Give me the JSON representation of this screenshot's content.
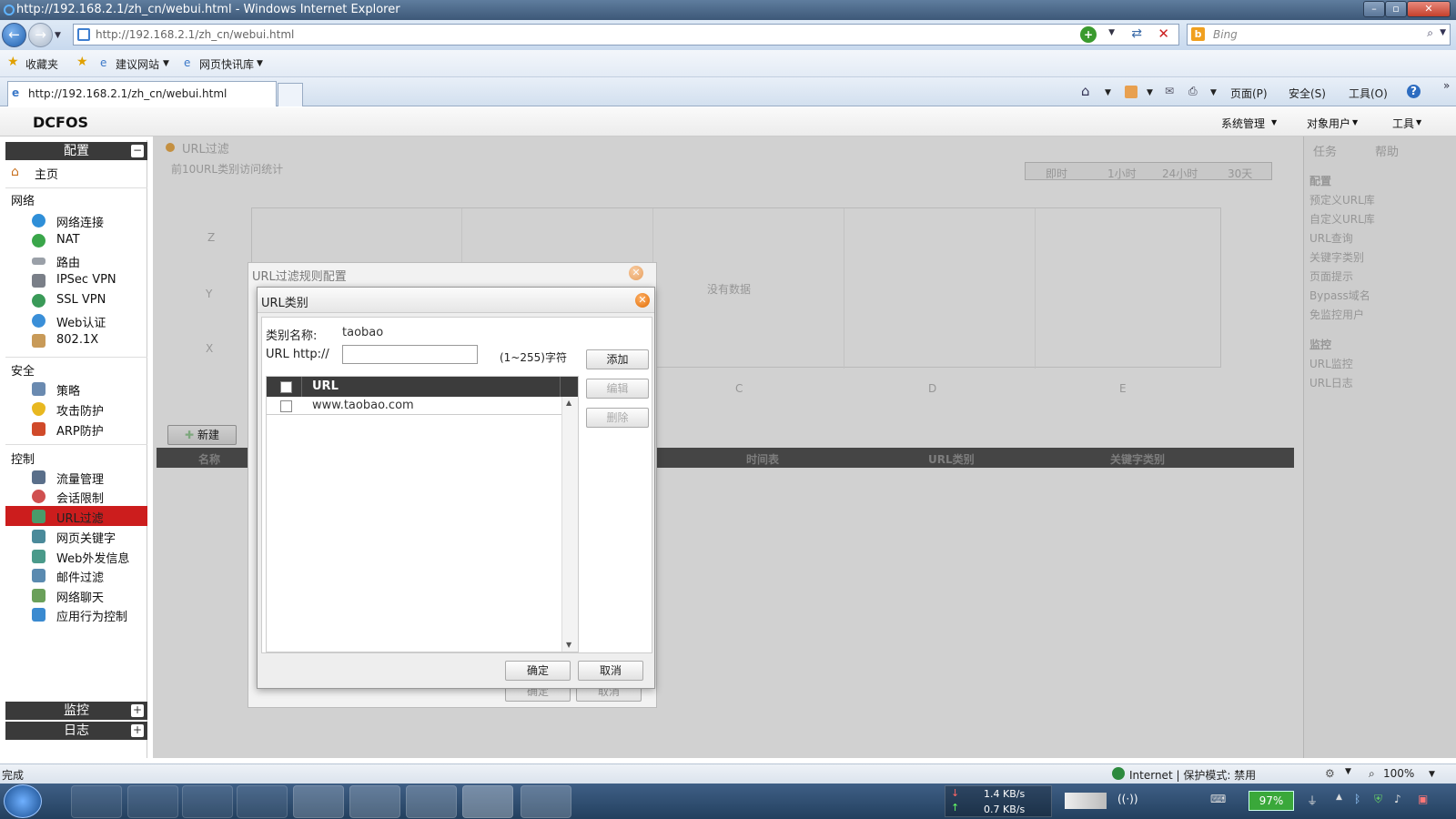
{
  "window": {
    "title": "http://192.168.2.1/zh_cn/webui.html - Windows Internet Explorer"
  },
  "browser": {
    "url": "http://192.168.2.1/zh_cn/webui.html",
    "search_placeholder": "Bing",
    "favorites": [
      "收藏夹",
      "建议网站",
      "网页快讯库"
    ],
    "tab_title": "http://192.168.2.1/zh_cn/webui.html",
    "commands": [
      "页面(P)",
      "安全(S)",
      "工具(O)"
    ]
  },
  "app": {
    "brand": "DCFOS",
    "top_menu": [
      "系统管理",
      "对象用户",
      "工具"
    ]
  },
  "sidebar": {
    "config_title": "配置",
    "home": "主页",
    "sections": [
      {
        "title": "网络",
        "items": [
          "网络连接",
          "NAT",
          "路由",
          "IPSec VPN",
          "SSL VPN",
          "Web认证",
          "802.1X"
        ]
      },
      {
        "title": "安全",
        "items": [
          "策略",
          "攻击防护",
          "ARP防护"
        ]
      },
      {
        "title": "控制",
        "items": [
          "流量管理",
          "会话限制",
          "URL过滤",
          "网页关键字",
          "Web外发信息",
          "邮件过滤",
          "网络聊天",
          "应用行为控制"
        ]
      }
    ],
    "active_item": "URL过滤",
    "monitor_title": "监控",
    "log_title": "日志"
  },
  "content": {
    "title": "URL过滤",
    "subtitle": "前10URL类别访问统计",
    "time_tabs": [
      "即时",
      "1小时",
      "24小时",
      "30天"
    ],
    "chart_y": [
      "Z",
      "Y",
      "X"
    ],
    "chart_x": [
      "C",
      "D",
      "E"
    ],
    "no_data": "没有数据",
    "new_btn": "新建",
    "table_cols": [
      "名称",
      "时间表",
      "URL类别",
      "关键字类别"
    ],
    "bg_ok": "确定",
    "bg_cancel": "取消"
  },
  "right_panel": {
    "tabs": [
      "任务",
      "帮助"
    ],
    "config_title": "配置",
    "config_items": [
      "预定义URL库",
      "自定义URL库",
      "URL查询",
      "关键字类别",
      "页面提示",
      "Bypass域名",
      "免监控用户"
    ],
    "monitor_title": "监控",
    "monitor_items": [
      "URL监控",
      "URL日志"
    ]
  },
  "dialog_back": {
    "title": "URL过滤规则配置"
  },
  "dialog": {
    "title": "URL类别",
    "category_label": "类别名称:",
    "category_value": "taobao",
    "url_label": "URL http://",
    "url_value": "",
    "url_hint": "(1~255)字符",
    "add_btn": "添加",
    "edit_btn": "编辑",
    "delete_btn": "删除",
    "table_header": "URL",
    "rows": [
      "www.taobao.com"
    ],
    "ok_btn": "确定",
    "cancel_btn": "取消"
  },
  "status": {
    "left": "完成",
    "zone": "Internet | 保护模式: 禁用",
    "zoom": "100%"
  },
  "taskbar": {
    "download_speed": "1.4 KB/s",
    "upload_speed": "0.7 KB/s",
    "battery": "97%"
  }
}
